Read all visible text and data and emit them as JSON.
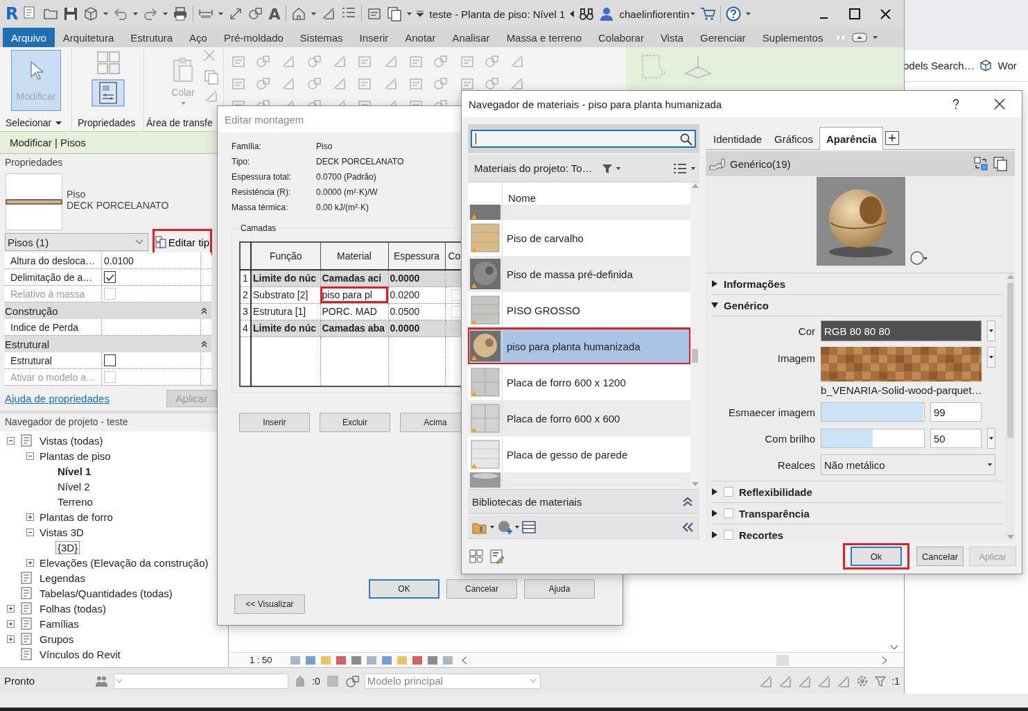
{
  "app": {
    "logo": "R",
    "text_tool": "A",
    "title": "teste - Planta de piso: Nível 1",
    "user": "chaelinfiorentin"
  },
  "ribbon_tabs": [
    {
      "label": "Arquivo",
      "selected": true
    },
    {
      "label": "Arquitetura",
      "selected": false
    },
    {
      "label": "Estrutura",
      "selected": false
    },
    {
      "label": "Aço",
      "selected": false
    },
    {
      "label": "Pré-moldado",
      "selected": false
    },
    {
      "label": "Sistemas",
      "selected": false
    },
    {
      "label": "Inserir",
      "selected": false
    },
    {
      "label": "Anotar",
      "selected": false
    },
    {
      "label": "Analisar",
      "selected": false
    },
    {
      "label": "Massa e terreno",
      "selected": false
    },
    {
      "label": "Colaborar",
      "selected": false
    },
    {
      "label": "Vista",
      "selected": false
    },
    {
      "label": "Gerenciar",
      "selected": false
    },
    {
      "label": "Suplementos",
      "selected": false
    }
  ],
  "ribbon": {
    "modify_button": {
      "label": "Modificar",
      "selected": true
    },
    "paste_button": {
      "label": "Colar",
      "disabled": true
    },
    "panels": [
      {
        "label": "Selecionar",
        "dropdown": true
      },
      {
        "label": "Propriedades",
        "dropdown": false
      },
      {
        "label": "Área de transfe",
        "dropdown": false
      }
    ]
  },
  "context_bar": {
    "label": "Modificar | Pisos"
  },
  "properties": {
    "title": "Propriedades",
    "family": "Piso",
    "type": "DECK PORCELANATO",
    "selector": "Pisos (1)",
    "edit_type": {
      "label": "Editar tip",
      "marked": true
    },
    "rows": [
      {
        "kind": "value",
        "label": "Altura do desloca…",
        "value": "0.0100"
      },
      {
        "kind": "check",
        "label": "Delimitação de a…",
        "checked": true,
        "disabled": false
      },
      {
        "kind": "check",
        "label": "Relativo à massa",
        "checked": false,
        "disabled": true
      },
      {
        "kind": "group",
        "label": "Construção"
      },
      {
        "kind": "value",
        "label": "Indice de Perda"
      },
      {
        "kind": "group",
        "label": "Estrutural"
      },
      {
        "kind": "check",
        "label": "Estrutural",
        "checked": false,
        "disabled": false
      },
      {
        "kind": "check",
        "label": "Ativar o modelo a…",
        "checked": false,
        "disabled": true
      }
    ],
    "help_link": "Ajuda de propriedades",
    "apply": "Aplicar"
  },
  "project_browser": {
    "title": "Navegador de projeto - teste",
    "tree": [
      {
        "label": "Vistas (todas)",
        "expanded": true,
        "children": [
          {
            "label": "Plantas de piso",
            "expanded": true,
            "children": [
              {
                "label": "Nível 1",
                "current": true
              },
              {
                "label": "Nível 2",
                "current": false
              },
              {
                "label": "Terreno",
                "current": false
              }
            ]
          },
          {
            "label": "Plantas de forro",
            "expanded": false
          },
          {
            "label": "Vistas 3D",
            "expanded": true,
            "children": [
              {
                "label": "{3D}",
                "focused": true
              }
            ]
          },
          {
            "label": "Elevações (Elevação da construção)",
            "expanded": false
          }
        ]
      },
      {
        "label": "Legendas"
      },
      {
        "label": "Tabelas/Quantidades (todas)"
      },
      {
        "label": "Folhas (todas)",
        "expanded": false
      },
      {
        "label": "Famílias",
        "expanded": false
      },
      {
        "label": "Grupos",
        "expanded": false
      },
      {
        "label": "Vínculos do Revit"
      }
    ]
  },
  "view_bar": {
    "scale": "1 : 50"
  },
  "status_bar": {
    "status": "Pronto",
    "selection_count": ":0",
    "model": "Modelo principal",
    "filter_count": ":1"
  },
  "side_browser": {
    "search_link": "odels Search…",
    "workspace": "Wor"
  },
  "edit_assembly": {
    "title": "Editar montagem",
    "info": [
      {
        "label": "Família:",
        "value": "Piso"
      },
      {
        "label": "Tipo:",
        "value": "DECK PORCELANATO"
      },
      {
        "label": "Espessura total:",
        "value": "0.0700 (Padrão)"
      },
      {
        "label": "Resistência (R):",
        "value": "0.0000 (m²·K)/W"
      },
      {
        "label": "Massa térmica:",
        "value": "0.00 kJ/(m²·K)"
      }
    ],
    "layers_title": "Camadas",
    "columns": [
      "Função",
      "Material",
      "Espessura",
      "Co"
    ],
    "rows": [
      {
        "kind": "boundary",
        "number": "1",
        "function": "Limite do núc",
        "material": "Camadas aci",
        "thickness": "0.0000",
        "marked": false
      },
      {
        "kind": "layer",
        "number": "2",
        "function": "Substrato [2]",
        "material": "piso para pl",
        "thickness": "0.0200",
        "marked": true,
        "checked": false
      },
      {
        "kind": "layer",
        "number": "3",
        "function": "Estrutura [1]",
        "material": "PORC. MAD",
        "thickness": "0.0500",
        "marked": false,
        "checked": false
      },
      {
        "kind": "boundary",
        "number": "4",
        "function": "Limite do núc",
        "material": "Camadas aba",
        "thickness": "0.0000",
        "marked": false
      }
    ],
    "row_buttons": [
      "Inserir",
      "Excluir",
      "Acima"
    ],
    "buttons": [
      "OK",
      "Cancelar",
      "Ajuda"
    ],
    "preview_button": "<< Visualizar"
  },
  "material_browser": {
    "title": "Navegador de materiais - piso para planta humanizada",
    "filter_label": "Materiais do projeto: To…",
    "column": "Nome",
    "items": [
      {
        "label": "Piso de carvalho",
        "kind": "cube",
        "color": "#d9b98a",
        "selected": false,
        "marked": false
      },
      {
        "label": "Piso de massa pré-definida",
        "kind": "sphere",
        "color": "#8a8a8a",
        "selected": false,
        "marked": false
      },
      {
        "label": "PISO GROSSO",
        "kind": "cube",
        "color": "#c4c4c0",
        "selected": false,
        "marked": false
      },
      {
        "label": "piso para planta humanizada",
        "kind": "sphere",
        "color": "#d7b689",
        "selected": true,
        "marked": true
      },
      {
        "label": "Placa de forro 600 x 1200",
        "kind": "tiles",
        "color": "#c8c8c8",
        "selected": false,
        "marked": false
      },
      {
        "label": "Placa de forro 600 x 600",
        "kind": "tiles",
        "color": "#d2d2d2",
        "selected": false,
        "marked": false
      },
      {
        "label": "Placa de gesso de parede",
        "kind": "cube",
        "color": "#e6e6e6",
        "selected": false,
        "marked": false
      }
    ],
    "library_label": "Bibliotecas de materiais",
    "tabs": [
      {
        "label": "Identidade",
        "selected": false
      },
      {
        "label": "Gráficos",
        "selected": false
      },
      {
        "label": "Aparência",
        "selected": true
      }
    ],
    "asset": "Genérico(19)",
    "sections": [
      {
        "label": "Informações",
        "expanded": false
      },
      {
        "label": "Genérico",
        "expanded": true
      }
    ],
    "generic": {
      "color_label": "Cor",
      "color_value": "RGB 80 80 80",
      "image_label": "Imagem",
      "image_file": "b_VENARIA-Solid-wood-parquet…",
      "fade_label": "Esmaecer imagem",
      "fade": {
        "level": 0.99,
        "value": "99"
      },
      "gloss_label": "Com brilho",
      "gloss": {
        "level": 0.5,
        "value": "50"
      },
      "highlights_label": "Realces",
      "highlights": "Não metálico"
    },
    "options": [
      {
        "label": "Reflexibilidade",
        "checked": false
      },
      {
        "label": "Transparência",
        "checked": false
      },
      {
        "label": "Recortes",
        "checked": false
      }
    ],
    "buttons": [
      {
        "label": "Ok",
        "marked": true,
        "disabled": false
      },
      {
        "label": "Cancelar",
        "marked": false,
        "disabled": false
      },
      {
        "label": "Aplicar",
        "marked": false,
        "disabled": true
      }
    ]
  }
}
